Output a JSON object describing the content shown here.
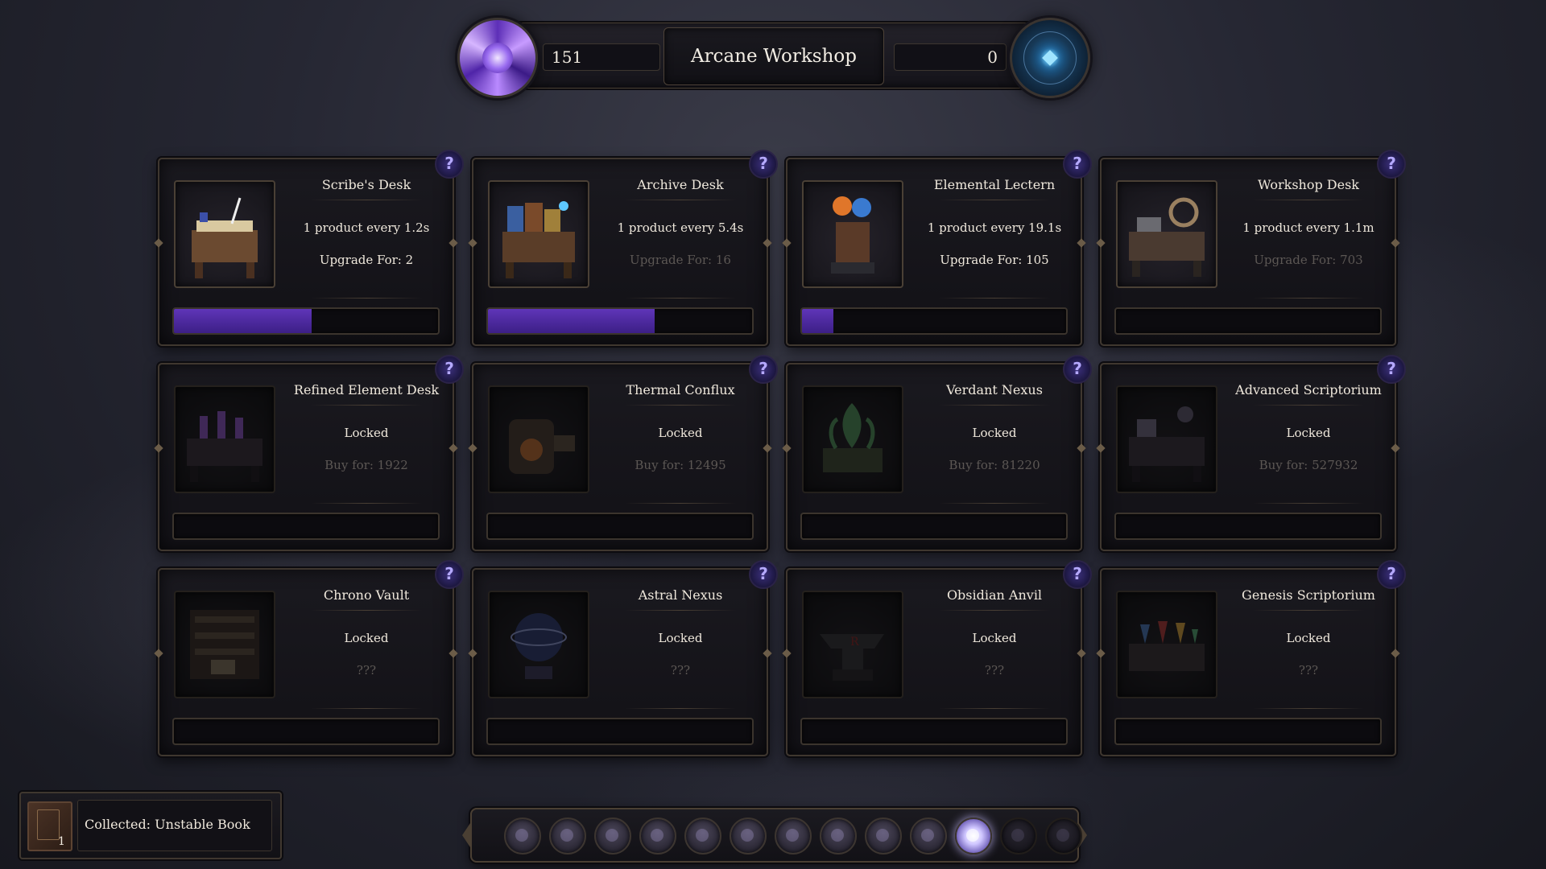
{
  "header": {
    "title": "Arcane Workshop",
    "left_counter": "151",
    "right_counter": "0"
  },
  "cards": [
    {
      "name": "Scribe's Desk",
      "line1": "1 product every 1.2s",
      "line2": "Upgrade For: 2",
      "line2_faded": false,
      "progress": 0.52,
      "locked": false,
      "icon": "scribes-desk-icon"
    },
    {
      "name": "Archive Desk",
      "line1": "1 product every 5.4s",
      "line2": "Upgrade For: 16",
      "line2_faded": true,
      "progress": 0.63,
      "locked": false,
      "icon": "archive-desk-icon"
    },
    {
      "name": "Elemental Lectern",
      "line1": "1 product every 19.1s",
      "line2": "Upgrade For: 105",
      "line2_faded": false,
      "progress": 0.12,
      "locked": false,
      "icon": "elemental-lectern-icon"
    },
    {
      "name": "Workshop Desk",
      "line1": "1 product every 1.1m",
      "line2": "Upgrade For: 703",
      "line2_faded": true,
      "progress": 0,
      "locked": false,
      "icon": "workshop-desk-icon"
    },
    {
      "name": "Refined Element Desk",
      "line1": "Locked",
      "line2": "Buy for: 1922",
      "line2_faded": true,
      "progress": 0,
      "locked": true,
      "icon": "refined-element-desk-icon"
    },
    {
      "name": "Thermal Conflux",
      "line1": "Locked",
      "line2": "Buy for: 12495",
      "line2_faded": true,
      "progress": 0,
      "locked": true,
      "icon": "thermal-conflux-icon"
    },
    {
      "name": "Verdant Nexus",
      "line1": "Locked",
      "line2": "Buy for: 81220",
      "line2_faded": true,
      "progress": 0,
      "locked": true,
      "icon": "verdant-nexus-icon"
    },
    {
      "name": "Advanced Scriptorium",
      "line1": "Locked",
      "line2": "Buy for: 527932",
      "line2_faded": true,
      "progress": 0,
      "locked": true,
      "icon": "advanced-scriptorium-icon"
    },
    {
      "name": "Chrono Vault",
      "line1": "Locked",
      "line2": "???",
      "line2_faded": true,
      "progress": 0,
      "locked": true,
      "icon": "chrono-vault-icon"
    },
    {
      "name": "Astral Nexus",
      "line1": "Locked",
      "line2": "???",
      "line2_faded": true,
      "progress": 0,
      "locked": true,
      "icon": "astral-nexus-icon"
    },
    {
      "name": "Obsidian Anvil",
      "line1": "Locked",
      "line2": "???",
      "line2_faded": true,
      "progress": 0,
      "locked": true,
      "icon": "obsidian-anvil-icon"
    },
    {
      "name": "Genesis Scriptorium",
      "line1": "Locked",
      "line2": "???",
      "line2_faded": true,
      "progress": 0,
      "locked": true,
      "icon": "genesis-scriptorium-icon"
    }
  ],
  "collected": {
    "message": "Collected: Unstable Book",
    "quantity": "1",
    "icon": "unstable-book-icon"
  },
  "navbar": {
    "buttons": [
      {
        "icon": "nav-icon-1",
        "active": false,
        "dim": false
      },
      {
        "icon": "nav-icon-2",
        "active": false,
        "dim": false
      },
      {
        "icon": "nav-icon-3",
        "active": false,
        "dim": false
      },
      {
        "icon": "nav-icon-4",
        "active": false,
        "dim": false
      },
      {
        "icon": "nav-icon-5",
        "active": false,
        "dim": false
      },
      {
        "icon": "nav-icon-6",
        "active": false,
        "dim": false
      },
      {
        "icon": "nav-icon-7",
        "active": false,
        "dim": false
      },
      {
        "icon": "nav-icon-8",
        "active": false,
        "dim": false
      },
      {
        "icon": "nav-icon-9",
        "active": false,
        "dim": false
      },
      {
        "icon": "nav-icon-10",
        "active": false,
        "dim": false
      },
      {
        "icon": "nav-icon-11",
        "active": true,
        "dim": false
      },
      {
        "icon": "nav-icon-12",
        "active": false,
        "dim": true
      },
      {
        "icon": "nav-icon-13",
        "active": false,
        "dim": true
      }
    ]
  },
  "colors": {
    "progress_fill": "#5f35b8",
    "help_icon": "#b5a9ff",
    "border": "#3f372f"
  }
}
